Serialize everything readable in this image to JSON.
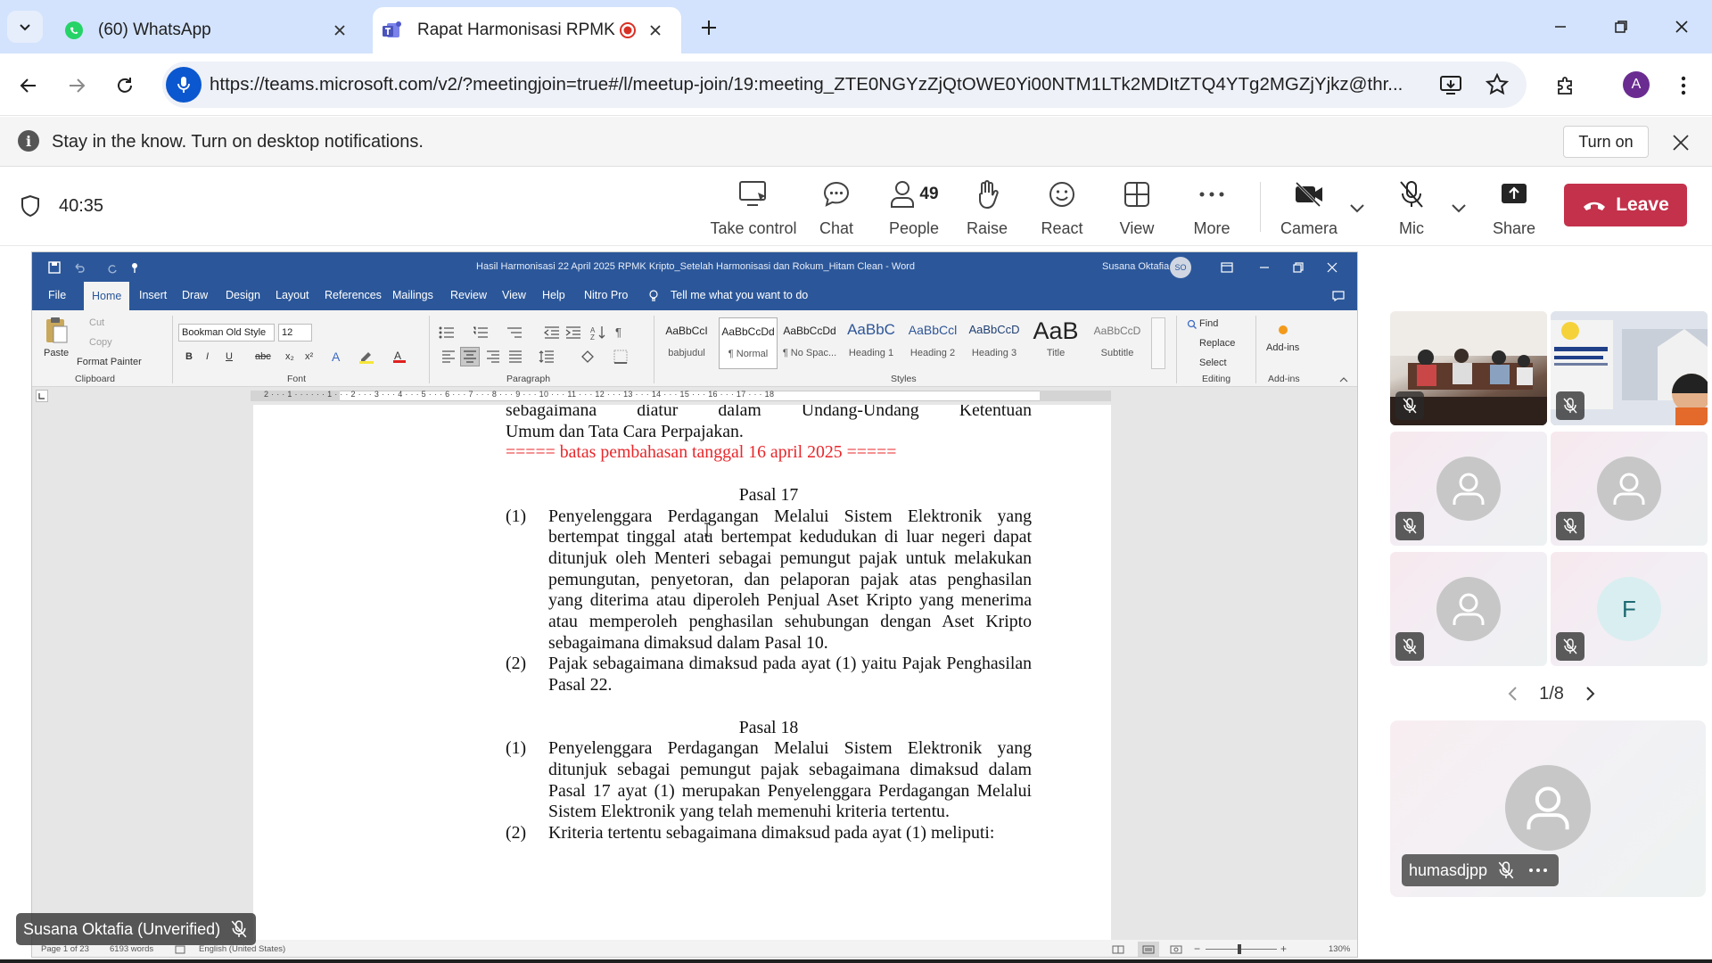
{
  "browser": {
    "tabs": [
      {
        "title": "(60) WhatsApp",
        "icon": "whatsapp-icon"
      },
      {
        "title": "Rapat Harmonisasi RPMK Kripto",
        "icon": "teams-icon"
      }
    ],
    "url": "https://teams.microsoft.com/v2/?meetingjoin=true#/l/meetup-join/19:meeting_ZTE0NGYzZjQtOWE0Yi00NTM1LTk2MDItZTQ4YTg2MGZjYjkz@thr...",
    "profile_initial": "A"
  },
  "notification": {
    "message": "Stay in the know. Turn on desktop notifications.",
    "turn_on_label": "Turn on"
  },
  "meeting": {
    "timer": "40:35",
    "controls": {
      "take_control": "Take control",
      "chat": "Chat",
      "people": "People",
      "people_count": "49",
      "raise": "Raise",
      "react": "React",
      "view": "View",
      "more": "More",
      "camera": "Camera",
      "mic": "Mic",
      "share": "Share",
      "leave": "Leave"
    },
    "pager": "1/8",
    "spotlight_name": "humasdjpp",
    "presenter_name": "Susana Oktafia (Unverified)",
    "tile_initial": "F"
  },
  "word": {
    "title": "Hasil Harmonisasi 22 April 2025 RPMK Kripto_Setelah Harmonisasi dan Rokum_Hitam Clean  -  Word",
    "user": "Susana Oktafia",
    "user_initials": "SO",
    "tabs": [
      "File",
      "Home",
      "Insert",
      "Draw",
      "Design",
      "Layout",
      "References",
      "Mailings",
      "Review",
      "View",
      "Help",
      "Nitro Pro"
    ],
    "tell_me": "Tell me what you want to do",
    "ribbon": {
      "paste": "Paste",
      "cut": "Cut",
      "copy": "Copy",
      "format_painter": "Format Painter",
      "clipboard": "Clipboard",
      "font_name": "Bookman Old Style",
      "font_size": "12",
      "font": "Font",
      "paragraph": "Paragraph",
      "styles_label": "Styles",
      "find": "Find",
      "replace": "Replace",
      "select": "Select",
      "editing": "Editing",
      "addins": "Add-ins",
      "addins_group": "Add-ins",
      "styles": [
        {
          "preview": "AaBbCcI",
          "name": "babjudul"
        },
        {
          "preview": "AaBbCcDd",
          "name": "¶ Normal"
        },
        {
          "preview": "AaBbCcDd",
          "name": "¶ No Spac..."
        },
        {
          "preview": "AaBbC",
          "name": "Heading 1"
        },
        {
          "preview": "AaBbCcl",
          "name": "Heading 2"
        },
        {
          "preview": "AaBbCcD",
          "name": "Heading 3"
        },
        {
          "preview": "AaB",
          "name": "Title"
        },
        {
          "preview": "AaBbCcD",
          "name": "Subtitle"
        }
      ]
    },
    "ruler_numbers": "2 · · · 1 · · · · · · 1 · · · 2 · · · 3 · · · 4 · · · 5 · · · 6 · · · 7 · · · 8 · · · 9 · · · 10 · · · 11 · · · 12 · · · 13 · · · 14 · · · 15 · · · 16 · · · 17 · · · 18",
    "document": {
      "line1": "sebagaimana diatur dalam Undang-Undang Ketentuan",
      "line2": "Umum dan Tata Cara Perpajakan.",
      "marker": "===== batas pembahasan tanggal 16 april 2025 =====",
      "pasal17": "Pasal 17",
      "p17_a1_num": "(1)",
      "p17_a1": "Penyelenggara Perdagangan Melalui Sistem Elektronik yang bertempat tinggal atau bertempat kedudukan di luar negeri dapat ditunjuk oleh Menteri sebagai pemungut pajak untuk melakukan pemungutan, penyetoran, dan pelaporan pajak atas penghasilan yang diterima atau diperoleh Penjual Aset Kripto yang menerima atau memperoleh penghasilan sehubungan dengan Aset Kripto sebagaimana dimaksud dalam Pasal 10.",
      "p17_a2_num": "(2)",
      "p17_a2": "Pajak sebagaimana dimaksud pada ayat (1) yaitu Pajak Penghasilan Pasal 22.",
      "pasal18": "Pasal 18",
      "p18_a1_num": "(1)",
      "p18_a1": "Penyelenggara Perdagangan Melalui Sistem Elektronik yang ditunjuk sebagai pemungut pajak sebagaimana dimaksud dalam Pasal 17 ayat (1) merupakan Penyelenggara Perdagangan Melalui Sistem Elektronik yang telah memenuhi kriteria tertentu.",
      "p18_a2_num": "(2)",
      "p18_a2": "Kriteria tertentu sebagaimana dimaksud pada ayat (1) meliputi:"
    },
    "status": {
      "page": "Page 1 of 23",
      "words": "6193 words",
      "language": "English (United States)",
      "zoom": "130%"
    }
  },
  "colors": {
    "word_blue": "#2b579a",
    "leave_red": "#c4314b",
    "marker_red": "#e8262a"
  }
}
